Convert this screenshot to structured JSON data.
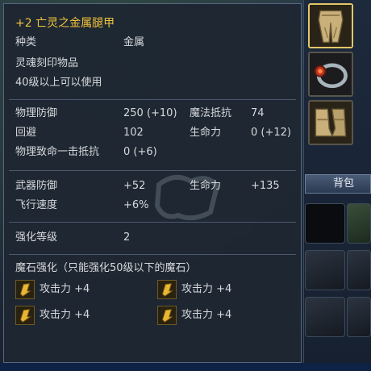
{
  "tooltip": {
    "title_prefix": "+2",
    "title": "亡灵之金属腿甲",
    "type_label": "种类",
    "type_value": "金属",
    "soul_bound": "灵魂刻印物品",
    "level_req": "40级以上可以使用",
    "stats_main": {
      "phys_def_label": "物理防御",
      "phys_def_value": "250 (+10)",
      "magic_res_label": "魔法抵抗",
      "magic_res_value": "74",
      "evade_label": "回避",
      "evade_value": "102",
      "hp_label": "生命力",
      "hp_value": "0 (+12)",
      "crit_res_label": "物理致命一击抵抗",
      "crit_res_value": "0 (+6)"
    },
    "stats_bonus": {
      "weapon_def_label": "武器防御",
      "weapon_def_value": "+52",
      "hp_label": "生命力",
      "hp_value": "+135",
      "fly_speed_label": "飞行速度",
      "fly_speed_value": "+6%"
    },
    "enhance": {
      "label": "强化等级",
      "value": "2"
    },
    "manastone": {
      "header": "魔石强化（只能强化50级以下的魔石）",
      "slots": [
        {
          "icon": "manastone-icon",
          "text": "攻击力 +4"
        },
        {
          "icon": "manastone-icon",
          "text": "攻击力 +4"
        },
        {
          "icon": "manastone-icon",
          "text": "攻击力 +4"
        },
        {
          "icon": "manastone-icon",
          "text": "攻击力 +4"
        }
      ]
    }
  },
  "inventory": {
    "bag_tab": "背包",
    "equip_icons": [
      "armor-pants-icon",
      "ring-icon",
      "armor-boots-icon"
    ]
  },
  "colors": {
    "title": "#f0c23c",
    "text": "#d7d9dc",
    "panel_bg": "#1e2632",
    "border": "#56677f"
  }
}
